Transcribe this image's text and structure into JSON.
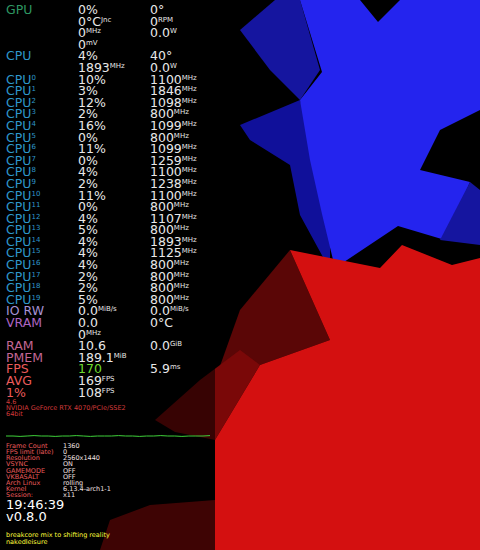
{
  "sections": [
    {
      "label": "GPU",
      "label_sup": "",
      "color": "#2e9762",
      "lines": [
        [
          {
            "value": "0%",
            "unit": ""
          },
          {
            "value": "0°",
            "unit": ""
          }
        ],
        [
          {
            "value": "0°C",
            "unit": "Jnc"
          },
          {
            "value": "0",
            "unit": "RPM"
          }
        ],
        [
          {
            "value": "0",
            "unit": "MHz"
          },
          {
            "value": "0.0",
            "unit": "W"
          }
        ],
        [
          {
            "value": "0",
            "unit": "mV"
          }
        ]
      ]
    },
    {
      "label": "CPU",
      "label_sup": "",
      "color": "#2e97cb",
      "lines": [
        [
          {
            "value": "4%",
            "unit": ""
          },
          {
            "value": "40°",
            "unit": ""
          }
        ],
        [
          {
            "value": "1893",
            "unit": "MHz"
          },
          {
            "value": "0.0",
            "unit": "W"
          }
        ]
      ]
    },
    {
      "label": "CPU",
      "label_sup": "0",
      "color": "#2e97cb",
      "lines": [
        [
          {
            "value": "10%",
            "unit": ""
          },
          {
            "value": "1100",
            "unit": "MHz"
          }
        ]
      ]
    },
    {
      "label": "CPU",
      "label_sup": "1",
      "color": "#2e97cb",
      "lines": [
        [
          {
            "value": "3%",
            "unit": ""
          },
          {
            "value": "1846",
            "unit": "MHz"
          }
        ]
      ]
    },
    {
      "label": "CPU",
      "label_sup": "2",
      "color": "#2e97cb",
      "lines": [
        [
          {
            "value": "12%",
            "unit": ""
          },
          {
            "value": "1098",
            "unit": "MHz"
          }
        ]
      ]
    },
    {
      "label": "CPU",
      "label_sup": "3",
      "color": "#2e97cb",
      "lines": [
        [
          {
            "value": "2%",
            "unit": ""
          },
          {
            "value": "800",
            "unit": "MHz"
          }
        ]
      ]
    },
    {
      "label": "CPU",
      "label_sup": "4",
      "color": "#2e97cb",
      "lines": [
        [
          {
            "value": "16%",
            "unit": ""
          },
          {
            "value": "1099",
            "unit": "MHz"
          }
        ]
      ]
    },
    {
      "label": "CPU",
      "label_sup": "5",
      "color": "#2e97cb",
      "lines": [
        [
          {
            "value": "0%",
            "unit": ""
          },
          {
            "value": "800",
            "unit": "MHz"
          }
        ]
      ]
    },
    {
      "label": "CPU",
      "label_sup": "6",
      "color": "#2e97cb",
      "lines": [
        [
          {
            "value": "11%",
            "unit": ""
          },
          {
            "value": "1099",
            "unit": "MHz"
          }
        ]
      ]
    },
    {
      "label": "CPU",
      "label_sup": "7",
      "color": "#2e97cb",
      "lines": [
        [
          {
            "value": "0%",
            "unit": ""
          },
          {
            "value": "1259",
            "unit": "MHz"
          }
        ]
      ]
    },
    {
      "label": "CPU",
      "label_sup": "8",
      "color": "#2e97cb",
      "lines": [
        [
          {
            "value": "4%",
            "unit": ""
          },
          {
            "value": "1100",
            "unit": "MHz"
          }
        ]
      ]
    },
    {
      "label": "CPU",
      "label_sup": "9",
      "color": "#2e97cb",
      "lines": [
        [
          {
            "value": "2%",
            "unit": ""
          },
          {
            "value": "1238",
            "unit": "MHz"
          }
        ]
      ]
    },
    {
      "label": "CPU",
      "label_sup": "10",
      "color": "#2e97cb",
      "lines": [
        [
          {
            "value": "11%",
            "unit": ""
          },
          {
            "value": "1100",
            "unit": "MHz"
          }
        ]
      ]
    },
    {
      "label": "CPU",
      "label_sup": "11",
      "color": "#2e97cb",
      "lines": [
        [
          {
            "value": "0%",
            "unit": ""
          },
          {
            "value": "800",
            "unit": "MHz"
          }
        ]
      ]
    },
    {
      "label": "CPU",
      "label_sup": "12",
      "color": "#2e97cb",
      "lines": [
        [
          {
            "value": "4%",
            "unit": ""
          },
          {
            "value": "1107",
            "unit": "MHz"
          }
        ]
      ]
    },
    {
      "label": "CPU",
      "label_sup": "13",
      "color": "#2e97cb",
      "lines": [
        [
          {
            "value": "5%",
            "unit": ""
          },
          {
            "value": "800",
            "unit": "MHz"
          }
        ]
      ]
    },
    {
      "label": "CPU",
      "label_sup": "14",
      "color": "#2e97cb",
      "lines": [
        [
          {
            "value": "4%",
            "unit": ""
          },
          {
            "value": "1893",
            "unit": "MHz"
          }
        ]
      ]
    },
    {
      "label": "CPU",
      "label_sup": "15",
      "color": "#2e97cb",
      "lines": [
        [
          {
            "value": "4%",
            "unit": ""
          },
          {
            "value": "1125",
            "unit": "MHz"
          }
        ]
      ]
    },
    {
      "label": "CPU",
      "label_sup": "16",
      "color": "#2e97cb",
      "lines": [
        [
          {
            "value": "4%",
            "unit": ""
          },
          {
            "value": "800",
            "unit": "MHz"
          }
        ]
      ]
    },
    {
      "label": "CPU",
      "label_sup": "17",
      "color": "#2e97cb",
      "lines": [
        [
          {
            "value": "2%",
            "unit": ""
          },
          {
            "value": "800",
            "unit": "MHz"
          }
        ]
      ]
    },
    {
      "label": "CPU",
      "label_sup": "18",
      "color": "#2e97cb",
      "lines": [
        [
          {
            "value": "2%",
            "unit": ""
          },
          {
            "value": "800",
            "unit": "MHz"
          }
        ]
      ]
    },
    {
      "label": "CPU",
      "label_sup": "19",
      "color": "#2e97cb",
      "lines": [
        [
          {
            "value": "5%",
            "unit": ""
          },
          {
            "value": "800",
            "unit": "MHz"
          }
        ]
      ]
    },
    {
      "label": "IO RW",
      "label_sup": "",
      "color": "#a491d3",
      "lines": [
        [
          {
            "value": "0.0",
            "unit": "MiB/s"
          },
          {
            "value": "0.0",
            "unit": "MiB/s"
          }
        ]
      ]
    },
    {
      "label": "VRAM",
      "label_sup": "",
      "color": "#ad64c1",
      "lines": [
        [
          {
            "value": "0.0",
            "unit": ""
          },
          {
            "value": "0°C",
            "unit": ""
          }
        ],
        [
          {
            "value": "0",
            "unit": "MHz"
          }
        ]
      ]
    },
    {
      "label": "RAM",
      "label_sup": "",
      "color": "#c26693",
      "lines": [
        [
          {
            "value": "10.6",
            "unit": ""
          },
          {
            "value": "0.0",
            "unit": "GiB"
          }
        ]
      ]
    },
    {
      "label": "PMEM",
      "label_sup": "",
      "color": "#c26693",
      "lines": [
        [
          {
            "value": "189.1",
            "unit": "MiB"
          }
        ]
      ]
    },
    {
      "label": "FPS",
      "label_sup": "",
      "color": "#eb5b5b",
      "lines": [
        [
          {
            "value": "170",
            "unit": "",
            "color": "#6ddb2e"
          },
          {
            "value": "5.9",
            "unit": "ms"
          }
        ]
      ]
    },
    {
      "label": "AVG",
      "label_sup": "",
      "color": "#eb5b5b",
      "lines": [
        [
          {
            "value": "169",
            "unit": "FPS"
          }
        ]
      ]
    },
    {
      "label": "1%",
      "label_sup": "",
      "color": "#eb5b5b",
      "lines": [
        [
          {
            "value": "108",
            "unit": "FPS"
          }
        ]
      ]
    }
  ],
  "gpu_info": {
    "version": "4.6",
    "renderer": "NVIDIA GeForce RTX 4070/PCIe/SSE2",
    "arch": "64bit"
  },
  "frametime": {
    "values": [
      5.9,
      5.9,
      5.8,
      5.9,
      6.0,
      5.9,
      5.9,
      5.8,
      5.9,
      5.9,
      6.0,
      5.9,
      5.8,
      5.9,
      5.9,
      5.9,
      6.0,
      5.9,
      5.9,
      5.8,
      5.9,
      5.9,
      6.0,
      5.9,
      5.9,
      5.8,
      5.9,
      5.9,
      5.9,
      6.0
    ]
  },
  "engine": [
    {
      "label": "Frame Count",
      "value": "1360"
    },
    {
      "label": "FPS limit (late)",
      "value": "0"
    },
    {
      "label": "Resolution",
      "value": "2560x1440"
    },
    {
      "label": "VSYNC",
      "value": "ON"
    },
    {
      "label": "GAMEMODE",
      "value": "OFF"
    },
    {
      "label": "VKBASALT",
      "value": "OFF"
    },
    {
      "label": "Arch Linux",
      "value": "rolling"
    },
    {
      "label": "Kernel",
      "value": "6.13.4-arch1-1"
    },
    {
      "label": "Session:",
      "value": "x11"
    }
  ],
  "clock": "19:46:39",
  "version": "v0.8.0",
  "media": {
    "title": "breakcore mix to shifting reality",
    "artist": "nakedleisure"
  }
}
